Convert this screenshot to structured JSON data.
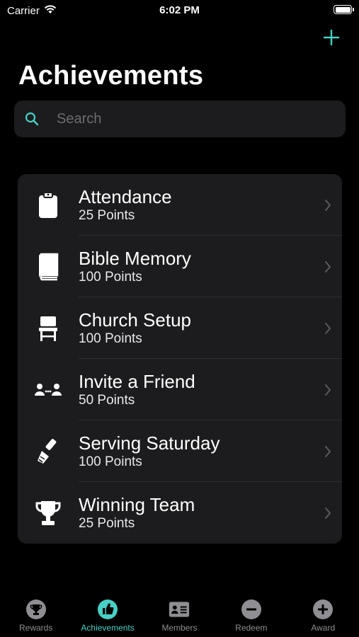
{
  "status_bar": {
    "carrier": "Carrier",
    "time": "6:02 PM"
  },
  "header": {
    "title": "Achievements",
    "add_icon": "plus-icon"
  },
  "search": {
    "placeholder": "Search",
    "value": ""
  },
  "achievements": [
    {
      "title": "Attendance",
      "points": "25 Points",
      "icon": "clipboard-icon"
    },
    {
      "title": "Bible Memory",
      "points": "100 Points",
      "icon": "book-icon"
    },
    {
      "title": "Church Setup",
      "points": "100 Points",
      "icon": "chair-icon"
    },
    {
      "title": "Invite a Friend",
      "points": "50 Points",
      "icon": "people-icon"
    },
    {
      "title": "Serving Saturday",
      "points": "100 Points",
      "icon": "brush-icon"
    },
    {
      "title": "Winning Team",
      "points": "25 Points",
      "icon": "trophy-icon"
    }
  ],
  "tabs": [
    {
      "label": "Rewards",
      "icon": "trophy-circle-icon",
      "active": false
    },
    {
      "label": "Achievements",
      "icon": "thumbs-up-circle-icon",
      "active": true
    },
    {
      "label": "Members",
      "icon": "id-card-icon",
      "active": false
    },
    {
      "label": "Redeem",
      "icon": "minus-circle-icon",
      "active": false
    },
    {
      "label": "Award",
      "icon": "plus-circle-icon",
      "active": false
    }
  ],
  "colors": {
    "accent": "#48d1c4",
    "background": "#000000",
    "card": "#1c1c1e",
    "inactive": "#8e8e93"
  }
}
